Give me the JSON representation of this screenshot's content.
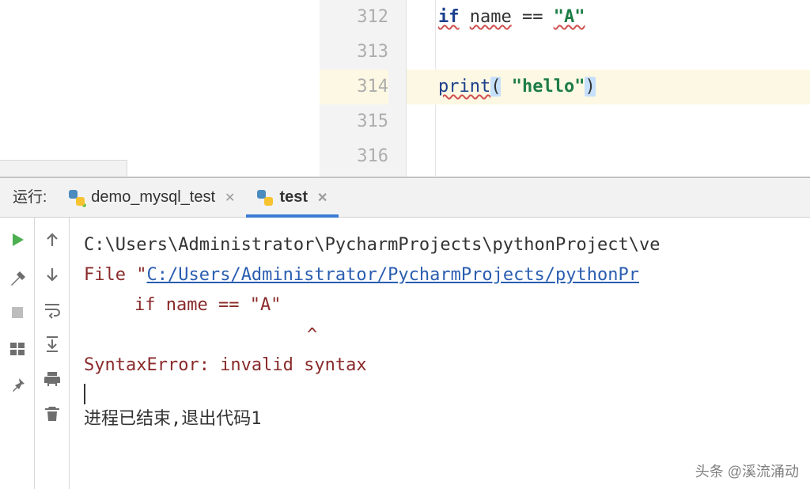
{
  "editor": {
    "lines": [
      {
        "num": "312",
        "segments": [
          {
            "t": "if",
            "cls": "kw errline"
          },
          {
            "t": " ",
            "cls": ""
          },
          {
            "t": "name",
            "cls": "errline punc"
          },
          {
            "t": " == ",
            "cls": "punc"
          },
          {
            "t": "\"A\"",
            "cls": "str errline"
          }
        ]
      },
      {
        "num": "313",
        "segments": []
      },
      {
        "num": "314",
        "current": true,
        "segments": [
          {
            "t": "print",
            "cls": "fn errline"
          },
          {
            "t": "(",
            "cls": "punc sel"
          },
          {
            "t": " ",
            "cls": "punc"
          },
          {
            "t": "\"hello\"",
            "cls": "str"
          },
          {
            "t": ")",
            "cls": "punc sel"
          }
        ]
      },
      {
        "num": "315",
        "segments": []
      },
      {
        "num": "316",
        "segments": []
      }
    ]
  },
  "run": {
    "label": "运行:",
    "tabs": [
      {
        "name": "demo_mysql_test",
        "active": false
      },
      {
        "name": "test",
        "active": true
      }
    ],
    "console": {
      "cmd": "C:\\Users\\Administrator\\PycharmProjects\\pythonProject\\ve",
      "file_prefix": "  File \"",
      "file_link": "C:/Users/Administrator/PycharmProjects/pythonPr",
      "code_echo": "if name == \"A\"",
      "caret": "^",
      "error": "SyntaxError: invalid syntax",
      "exit": "进程已结束,退出代码1"
    }
  },
  "watermark": "头条 @溪流涌动"
}
